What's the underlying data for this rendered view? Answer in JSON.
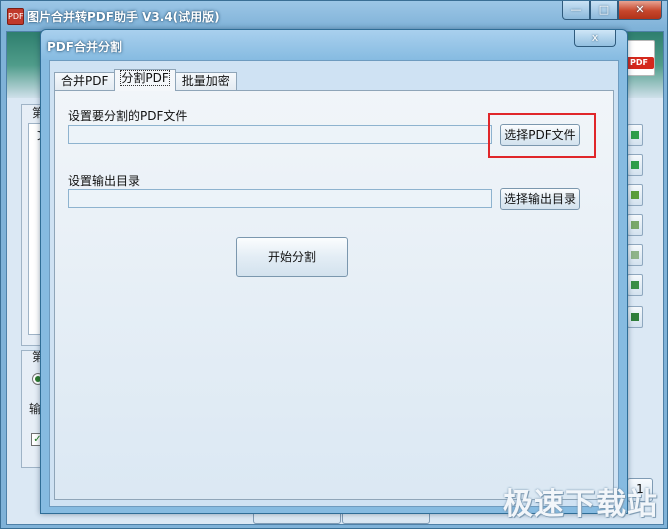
{
  "main_window": {
    "title": "图片合并转PDF助手 V3.4(试用版)",
    "logo_text": "PDF",
    "buttons": {
      "minimize": "—",
      "maximize": "□",
      "close": "✕"
    },
    "background_fragments": {
      "group1_label": "第",
      "list_header": "文",
      "group2_label": "第",
      "output_label": "输",
      "bottom_right_btn": "1"
    }
  },
  "dialog": {
    "title": "PDF合并分割",
    "close_label": "x",
    "tabs": [
      {
        "label": "合并PDF",
        "active": false
      },
      {
        "label": "分割PDF",
        "active": true
      },
      {
        "label": "批量加密",
        "active": false
      }
    ],
    "split_panel": {
      "file_label": "设置要分割的PDF文件",
      "file_value": "",
      "select_file_button": "选择PDF文件",
      "output_label": "设置输出目录",
      "output_value": "",
      "select_output_button": "选择输出目录",
      "start_button": "开始分割"
    }
  },
  "watermark": "极速下载站",
  "colors": {
    "titlebar": "#86bbe1",
    "highlight": "#e0262a",
    "pdf_red": "#d4281c"
  }
}
